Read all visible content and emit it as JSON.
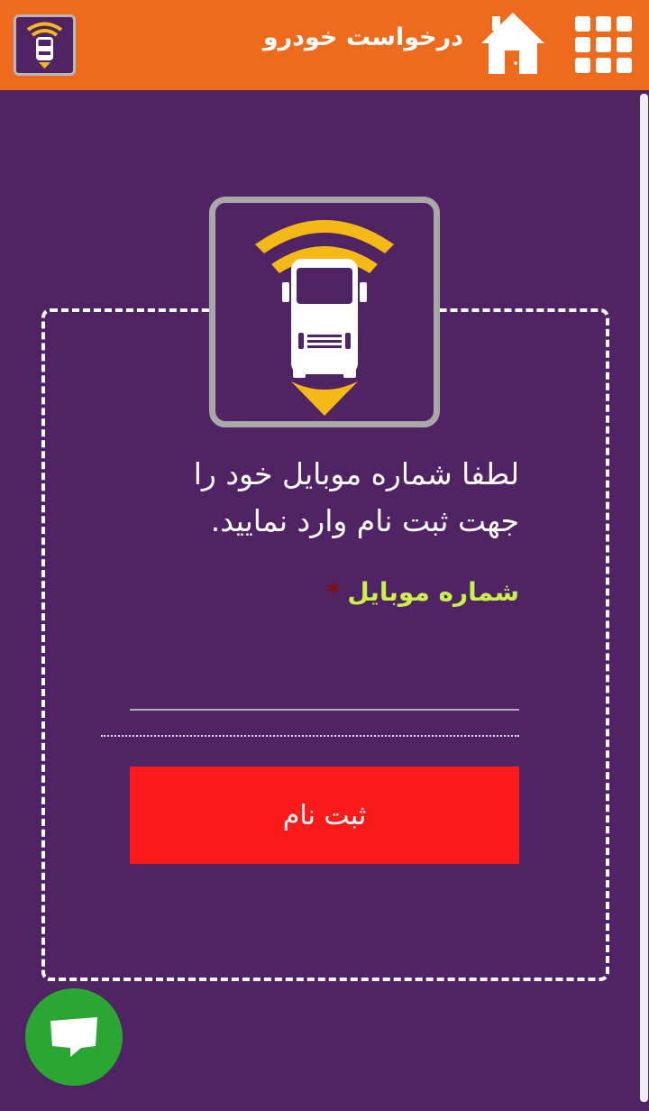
{
  "header": {
    "title": "درخواست خودرو",
    "icons": {
      "logo": "truck-signal-logo-icon",
      "home": "home-icon",
      "menu": "grid-menu-icon"
    },
    "color": "#ee6a1d"
  },
  "main": {
    "logo_icon": "truck-signal-logo-icon",
    "prompt_line1": "لطفا شماره موبایل خود را",
    "prompt_line2": "جهت ثبت نام وارد نمایید.",
    "field_label": "شماره موبایل",
    "required_marker": "*",
    "mobile_value": "",
    "register_label": "ثبت نام"
  },
  "chat": {
    "icon": "chat-bubble-icon"
  },
  "colors": {
    "background": "#502464",
    "accent_label": "#c9f14a",
    "button": "#fb1a1a",
    "fab": "#2aa633",
    "logo_yellow": "#f5b915"
  }
}
